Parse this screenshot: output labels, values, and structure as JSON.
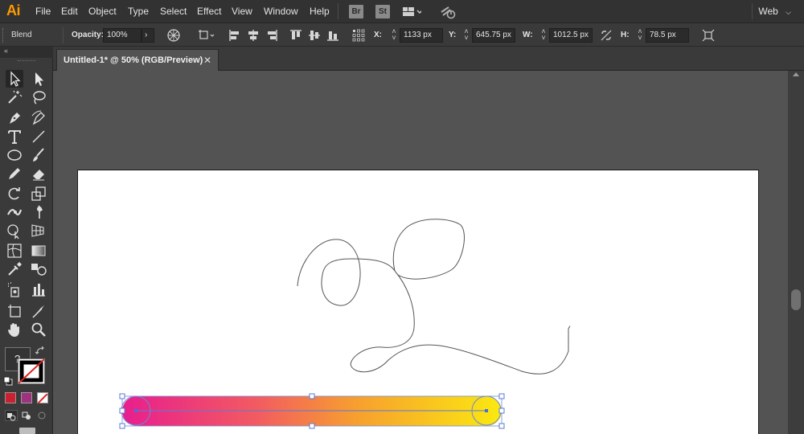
{
  "app": {
    "logo": "Ai"
  },
  "menu": {
    "items": [
      "File",
      "Edit",
      "Object",
      "Type",
      "Select",
      "Effect",
      "View",
      "Window",
      "Help"
    ],
    "bridge": "Br",
    "stock": "St",
    "workspace": "Web"
  },
  "control": {
    "mode": "Blend",
    "opacity_label": "Opacity:",
    "opacity_value": "100%",
    "x_label": "X:",
    "x_value": "1133 px",
    "y_label": "Y:",
    "y_value": "645.75 px",
    "w_label": "W:",
    "w_value": "1012.5 px",
    "h_label": "H:",
    "h_value": "78.5 px"
  },
  "toolbar": {
    "fill_unknown": "?"
  },
  "document": {
    "tab_title": "Untitled-1* @ 50% (RGB/Preview)",
    "close_glyph": "✕"
  },
  "colors": {
    "accent": "#ff9a00",
    "selection": "#4a86e8",
    "gradient_start": "#e8208c",
    "gradient_end": "#fbe80e"
  }
}
